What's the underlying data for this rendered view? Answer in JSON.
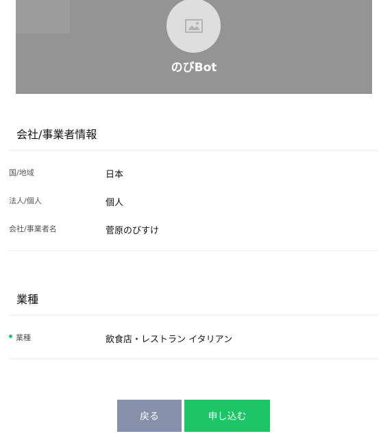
{
  "profile": {
    "bot_name": "のびBot",
    "avatar_icon": "image-placeholder-icon"
  },
  "company_section": {
    "title": "会社/事業者情報",
    "rows": [
      {
        "label": "国/地域",
        "value": "日本"
      },
      {
        "label": "法人/個人",
        "value": "個人"
      },
      {
        "label": "会社/事業者名",
        "value": "菅原のびすけ"
      }
    ]
  },
  "industry_section": {
    "title": "業種",
    "rows": [
      {
        "label": "業種",
        "value": "飲食店・レストラン イタリアン",
        "required": true
      }
    ]
  },
  "actions": {
    "back_label": "戻る",
    "apply_label": "申し込む"
  },
  "colors": {
    "banner": "#949494",
    "avatar_bg": "#dedede",
    "primary_green": "#1ec567",
    "back_button": "#8790ab"
  }
}
